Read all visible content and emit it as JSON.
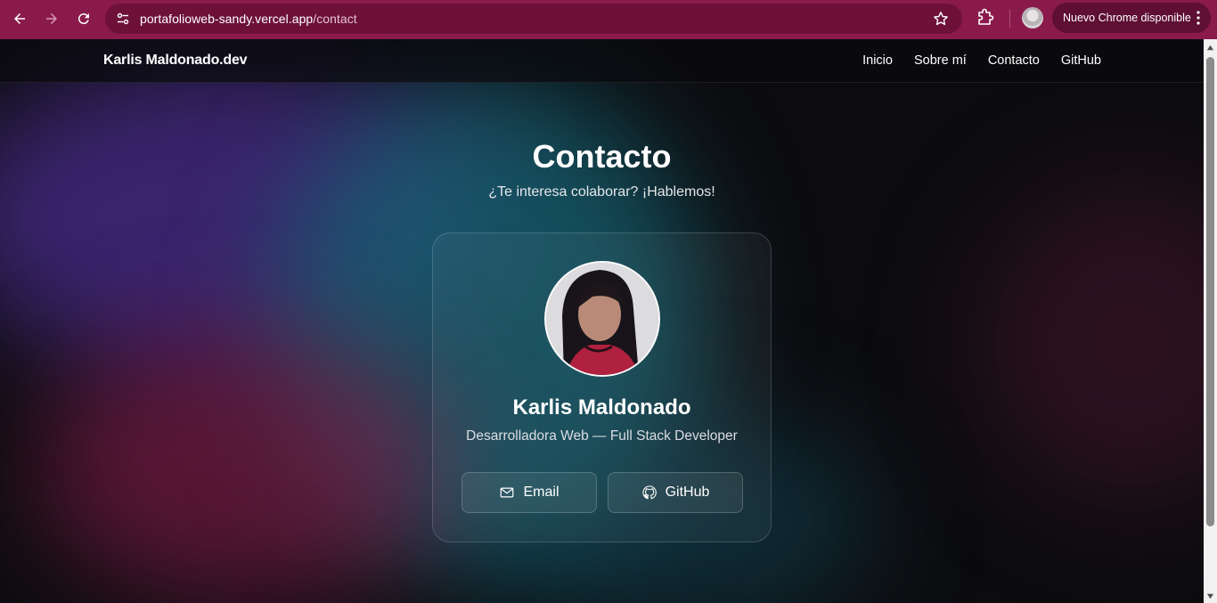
{
  "browser": {
    "url_host": "portafolioweb-sandy.vercel.app",
    "url_path": "/contact",
    "update_label": "Nuevo Chrome disponible"
  },
  "site": {
    "brand": "Karlis Maldonado.dev",
    "nav": [
      "Inicio",
      "Sobre mí",
      "Contacto",
      "GitHub"
    ]
  },
  "page": {
    "title": "Contacto",
    "subtitle": "¿Te interesa colaborar? ¡Hablemos!"
  },
  "card": {
    "name": "Karlis Maldonado",
    "role": "Desarrolladora Web — Full Stack Developer",
    "email_label": "Email",
    "github_label": "GitHub"
  },
  "icons": {
    "back": "arrow-left-icon",
    "forward": "arrow-right-icon",
    "reload": "reload-icon",
    "site_settings": "tune-icon",
    "bookmark": "star-icon",
    "extensions": "puzzle-icon",
    "menu": "more-vert-icon",
    "email": "mail-icon",
    "github": "github-icon"
  },
  "colors": {
    "chrome_toolbar": "#8a1a4c",
    "omnibox": "#6d1139",
    "page_bg": "#0c0c0f",
    "text": "#ffffff"
  }
}
